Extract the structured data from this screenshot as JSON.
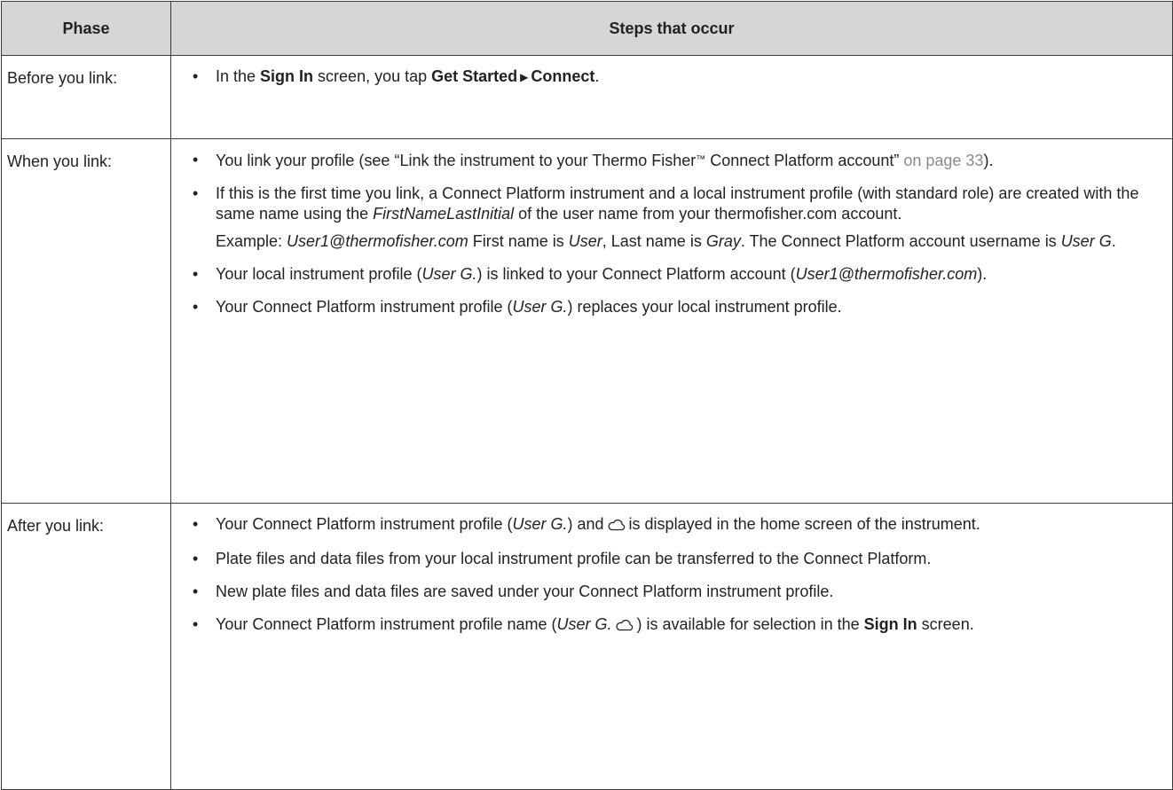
{
  "table": {
    "header": {
      "phase": "Phase",
      "steps": "Steps that occur"
    },
    "rows": [
      {
        "phase": "Before you link:",
        "steps": [
          {
            "t1": "In the ",
            "b1": "Sign In",
            "t2": " screen, you tap ",
            "b2": "Get Started",
            "arrow": "▶",
            "b3": "Connect",
            "t3": "."
          }
        ]
      },
      {
        "phase": "When you link:",
        "steps": [
          {
            "t1": "You link your profile (see “Link the instrument to your Thermo Fisher",
            "tm": "™",
            "t2": " Connect Platform account” ",
            "link": "on page 33",
            "t3": ")."
          },
          {
            "t1": "If this is the first time you link, a Connect Platform instrument and a local instrument profile (with standard role) are created with the same name using the ",
            "i1": "FirstNameLastInitial",
            "t2": " of the user name from your thermofisher.com account.",
            "sub": {
              "t1": "Example: ",
              "i1": "User1@thermofisher.com",
              "t2": " First name is ",
              "i2": "User",
              "t3": ", Last name is ",
              "i3": "Gray",
              "t4": ". The Connect Platform account username is ",
              "i4": "User G",
              "t5": "."
            }
          },
          {
            "t1": "Your local instrument profile (",
            "i1": "User G.",
            "t2": ") is linked to your Connect Platform account (",
            "i2": "User1@thermofisher.com",
            "t3": ")."
          },
          {
            "t1": "Your Connect Platform instrument profile (",
            "i1": "User G.",
            "t2": ") replaces your local instrument profile."
          }
        ]
      },
      {
        "phase": "After you link:",
        "steps": [
          {
            "t1": "Your Connect Platform instrument profile (",
            "i1": "User G.",
            "t2": ") and",
            "icon": "cloud-icon",
            "t3": "is displayed in the home screen of the instrument."
          },
          {
            "t1": "Plate files and data files from your local instrument profile can be transferred to the Connect Platform."
          },
          {
            "t1": "New plate files and data files are saved under your Connect Platform instrument profile."
          },
          {
            "t1": "Your Connect Platform instrument profile name (",
            "i1": "User G.",
            "icon": "cloud-icon",
            "t2": ") is available for selection in the ",
            "b1": "Sign In",
            "t3": " screen."
          }
        ]
      }
    ],
    "bullet": "•"
  },
  "colors": {
    "header_bg": "#d6d6d6",
    "border": "#3c3c3c",
    "text": "#222222",
    "link": "#8a8a8a"
  }
}
